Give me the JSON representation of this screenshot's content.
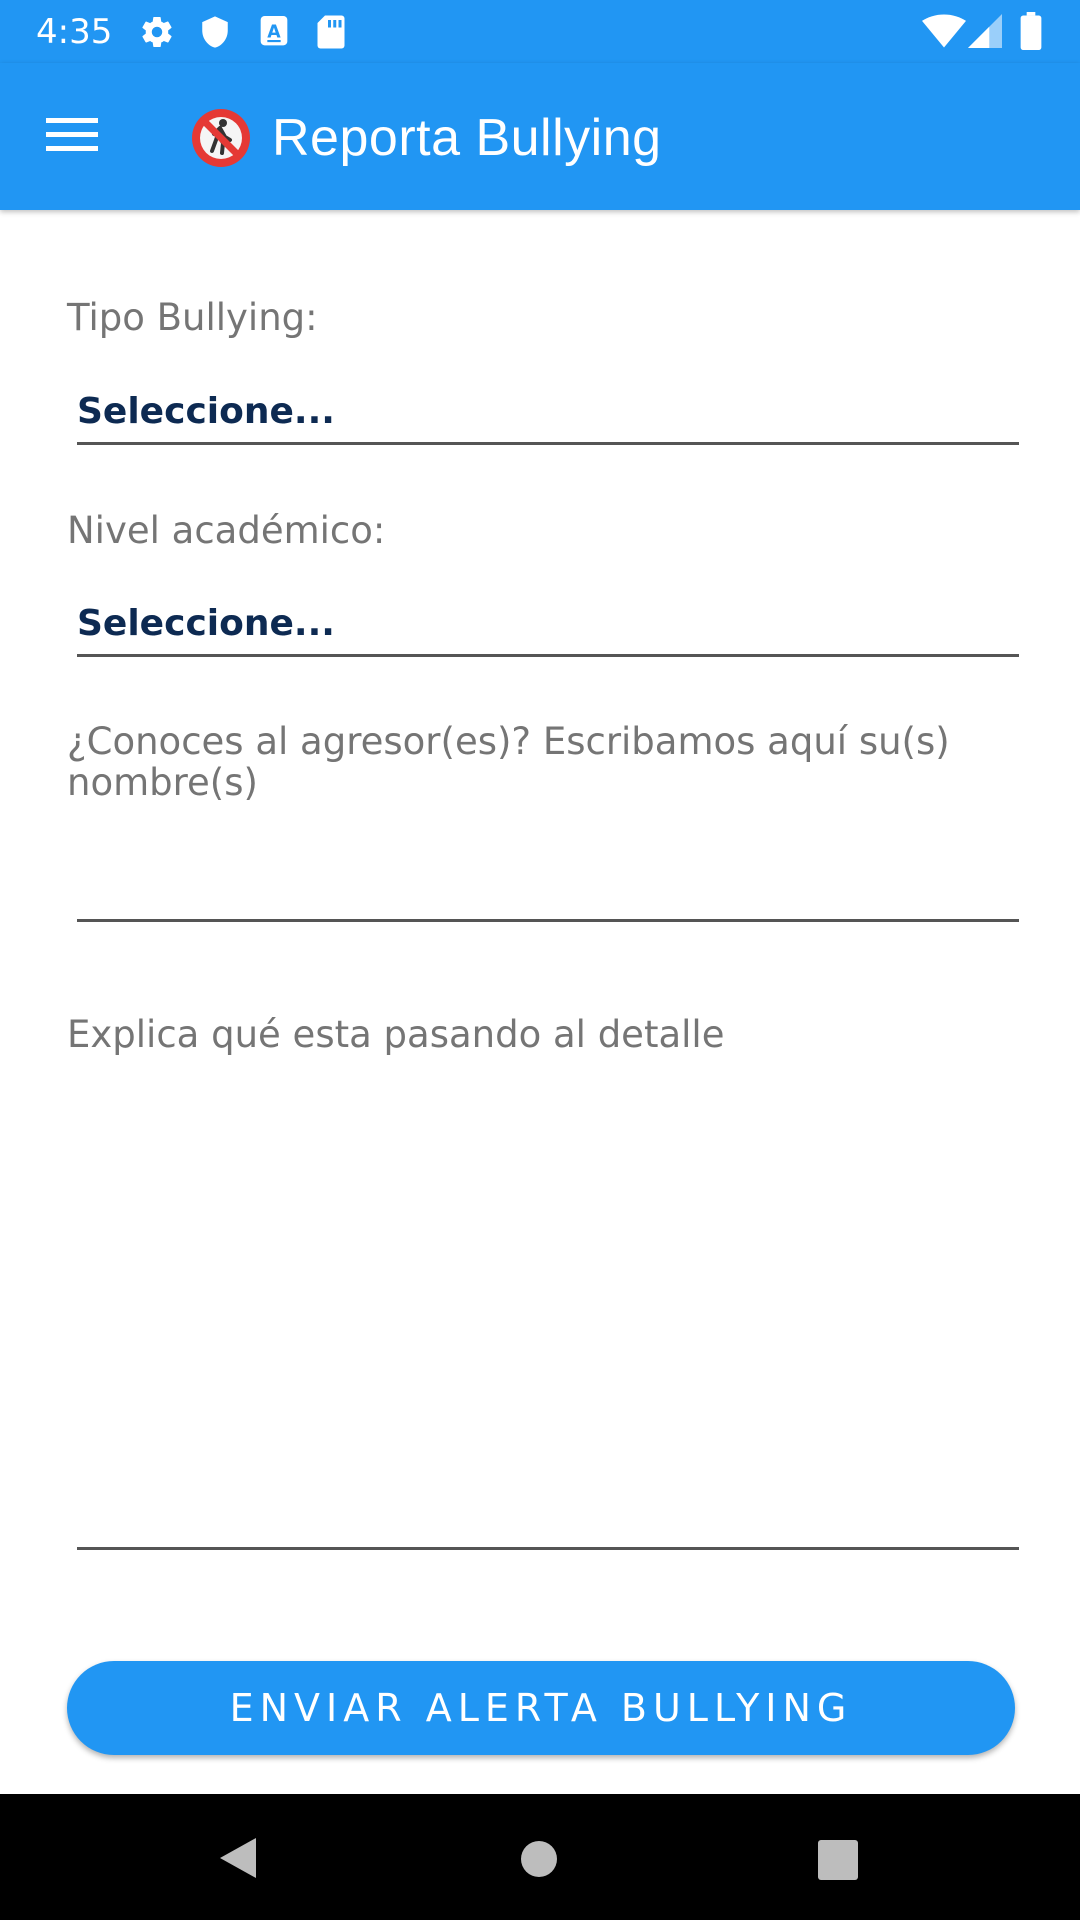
{
  "status_bar": {
    "time": "4:35",
    "icons": [
      "settings-icon",
      "shield-icon",
      "text-notification-icon",
      "sd-card-icon",
      "wifi-icon",
      "signal-icon",
      "battery-icon"
    ]
  },
  "app_bar": {
    "title": "Reporta Bullying",
    "logo_icon": "no-pedestrian-icon",
    "menu_icon": "hamburger-menu-icon",
    "background_color": "#2196F3"
  },
  "form": {
    "tipo_label": "Tipo Bullying:",
    "tipo_value": "Seleccione...",
    "nivel_label": "Nivel académico:",
    "nivel_value": "Seleccione...",
    "agresor_label": "¿Conoces al agresor(es)? Escribamos aquí su(s) nombre(s)",
    "agresor_value": "",
    "detalle_label": "Explica qué esta pasando al detalle",
    "detalle_value": ""
  },
  "submit_button": {
    "label": "ENVIAR ALERTA BULLYING",
    "color": "#2196F3"
  },
  "nav_bar": {
    "icons": [
      "back-icon",
      "home-icon",
      "recents-icon"
    ]
  }
}
